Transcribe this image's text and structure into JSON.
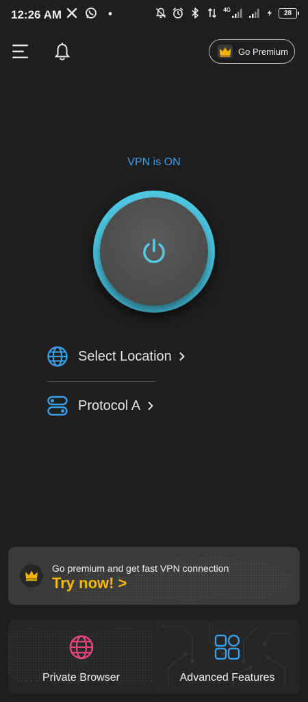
{
  "status_bar": {
    "time": "12:26 AM",
    "network_label": "4G",
    "battery": "28"
  },
  "header": {
    "menu_icon": "hamburger-menu-icon",
    "notification_icon": "bell-icon",
    "premium_label": "Go Premium"
  },
  "vpn": {
    "status": "VPN is ON",
    "accent_color": "#3aa0e8"
  },
  "options": {
    "location_label": "Select Location",
    "protocol_label": "Protocol A"
  },
  "promo": {
    "title": "Go premium and get fast VPN connection",
    "cta": "Try now! >",
    "cta_color": "#f5b800"
  },
  "cards": {
    "browser_label": "Private Browser",
    "features_label": "Advanced Features"
  }
}
